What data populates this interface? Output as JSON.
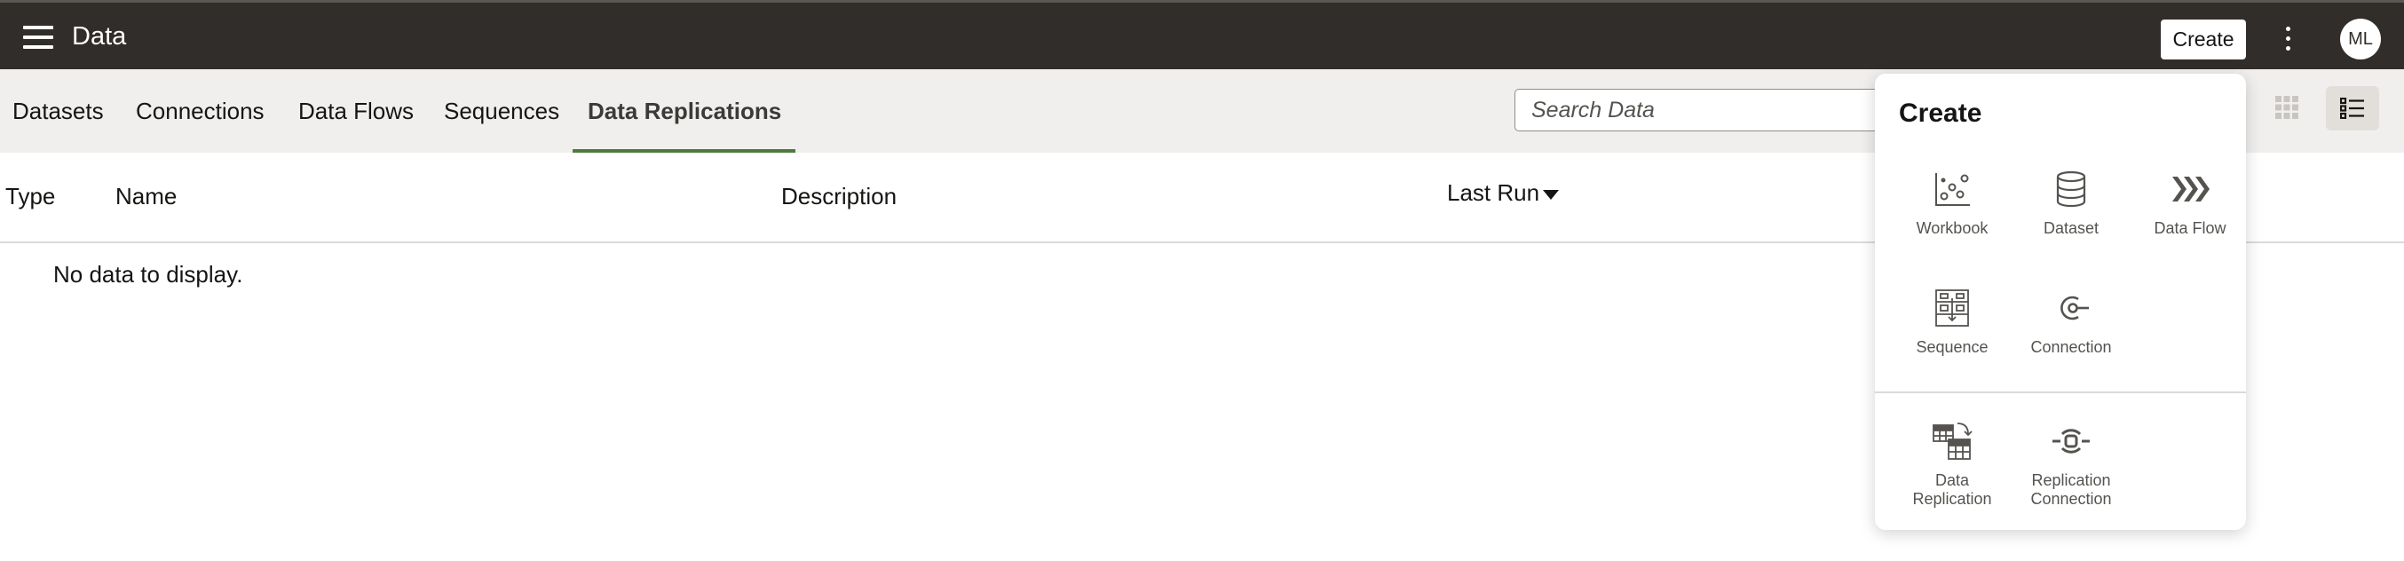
{
  "header": {
    "title": "Data",
    "create_label": "Create",
    "avatar_initials": "ML"
  },
  "tabs": [
    {
      "label": "Datasets",
      "active": false
    },
    {
      "label": "Connections",
      "active": false
    },
    {
      "label": "Data Flows",
      "active": false
    },
    {
      "label": "Sequences",
      "active": false
    },
    {
      "label": "Data Replications",
      "active": true
    }
  ],
  "search": {
    "placeholder": "Search Data",
    "value": ""
  },
  "table": {
    "columns": [
      "Type",
      "Name",
      "Description",
      "Last Run"
    ],
    "sorted_column": "Last Run",
    "sort_direction": "descending",
    "empty_message": "No data to display."
  },
  "create_menu": {
    "title": "Create",
    "items": [
      {
        "label": "Workbook",
        "icon": "workbook-icon"
      },
      {
        "label": "Dataset",
        "icon": "dataset-icon"
      },
      {
        "label": "Data Flow",
        "icon": "data-flow-icon"
      },
      {
        "label": "Sequence",
        "icon": "sequence-icon"
      },
      {
        "label": "Connection",
        "icon": "connection-icon"
      },
      {
        "label_line1": "Data",
        "label_line2": "Replication",
        "icon": "data-replication-icon"
      },
      {
        "label_line1": "Replication",
        "label_line2": "Connection",
        "icon": "replication-connection-icon"
      }
    ]
  },
  "colors": {
    "header_bg": "#312d2a",
    "tabbar_bg": "#f1efed",
    "active_tab_underline": "#4d7a40"
  }
}
